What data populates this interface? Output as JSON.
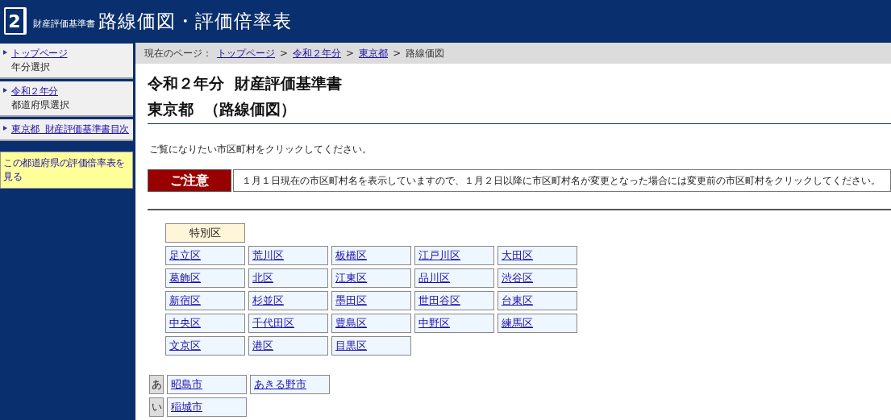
{
  "header": {
    "logo_number": "2",
    "subtitle": "財産評価基準書",
    "title": "路線価図・評価倍率表"
  },
  "sidebar": {
    "items": [
      {
        "link": "トップページ",
        "caption": "年分選択"
      },
      {
        "link": "令和２年分",
        "caption": "都道府県選択"
      },
      {
        "link": "東京都  財産評価基準書目次"
      }
    ],
    "notice_link": "この都道府県の評価倍率表を見る"
  },
  "breadcrumb": {
    "label": "現在のページ：",
    "links": [
      "トップページ",
      "令和２年分",
      "東京都"
    ],
    "separators": [
      ">",
      ">",
      ">"
    ],
    "current": "路線価図"
  },
  "heading": [
    "令和２年分  財産評価基準書",
    "東京都  （路線価図）"
  ],
  "instruction": "ご覧になりたい市区町村をクリックしてください。",
  "notice": {
    "label": "ご注意",
    "text": "１月１日現在の市区町村名を表示していますので、１月２日以降に市区町村名が変更となった場合には変更前の市区町村をクリックしてください。"
  },
  "wards": {
    "header": "特別区",
    "items": [
      "足立区",
      "荒川区",
      "板橋区",
      "江戸川区",
      "大田区",
      "葛飾区",
      "北区",
      "江東区",
      "品川区",
      "渋谷区",
      "新宿区",
      "杉並区",
      "墨田区",
      "世田谷区",
      "台東区",
      "中央区",
      "千代田区",
      "豊島区",
      "中野区",
      "練馬区",
      "文京区",
      "港区",
      "目黒区"
    ]
  },
  "kana_groups": [
    {
      "kana": "あ",
      "items": [
        "昭島市",
        "あきる野市"
      ]
    },
    {
      "kana": "い",
      "items": [
        "稲城市"
      ]
    }
  ]
}
